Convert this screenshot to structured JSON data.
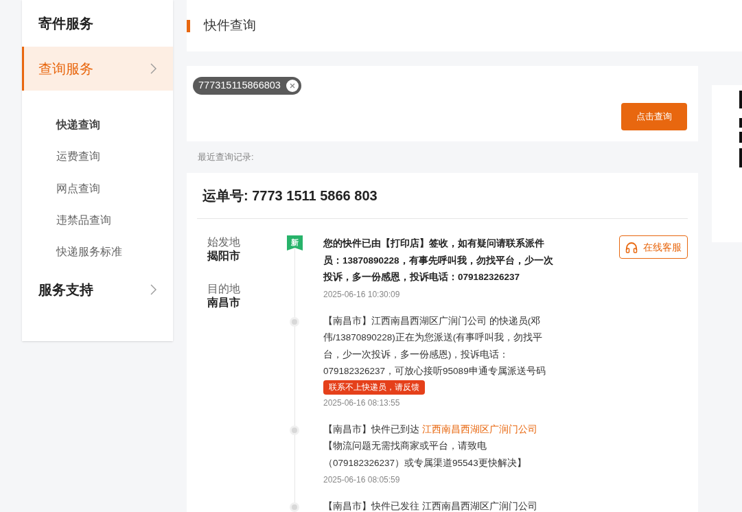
{
  "sidebar": {
    "sections": [
      {
        "title": "寄件服务",
        "selected": false,
        "has_arrow": false
      },
      {
        "title": "查询服务",
        "selected": true,
        "has_arrow": true,
        "items": [
          {
            "label": "快递查询",
            "selected": true
          },
          {
            "label": "运费查询",
            "selected": false
          },
          {
            "label": "网点查询",
            "selected": false
          },
          {
            "label": "违禁品查询",
            "selected": false
          },
          {
            "label": "快递服务标准",
            "selected": false
          }
        ]
      },
      {
        "title": "服务支持",
        "selected": false,
        "has_arrow": true
      }
    ]
  },
  "header": {
    "title": "快件查询"
  },
  "search": {
    "tags": [
      "777315115866803"
    ],
    "button": "点击查询"
  },
  "recent": {
    "label": "最近查询记录:"
  },
  "result": {
    "waybill_label": "运单号:",
    "waybill": "7773 1511 5866 803",
    "origin_label": "始发地",
    "origin": "揭阳市",
    "dest_label": "目的地",
    "dest": "南昌市",
    "service_button": "在线客服",
    "events": [
      {
        "latest": true,
        "marker": "新",
        "text": "您的快件已由【打印店】签收，如有疑问请联系派件员：13870890228，有事先呼叫我，勿找平台，少一次投诉，多一份感恩，投诉电话：079182326237",
        "time": "2025-06-16 10:30:09"
      },
      {
        "latest": false,
        "text": "【南昌市】江西南昌西湖区广润门公司 的快递员(邓伟/13870890228)正在为您派送(有事呼叫我，勿找平台，少一次投诉，多一份感恩)，投诉电话：079182326237，可放心接听95089申通专属派送号码",
        "badge": "联系不上快递员，请反馈",
        "time": "2025-06-16 08:13:55"
      },
      {
        "latest": false,
        "text": "【南昌市】快件已到达 ",
        "link": "江西南昌西湖区广润门公司",
        "after": "【物流问题无需找商家或平台，请致电（079182326237）或专属渠道95543更快解决】",
        "time": "2025-06-16 08:05:59"
      },
      {
        "latest": false,
        "text": "【南昌市】快件已发往 江西南昌西湖区广润门公司"
      }
    ]
  }
}
